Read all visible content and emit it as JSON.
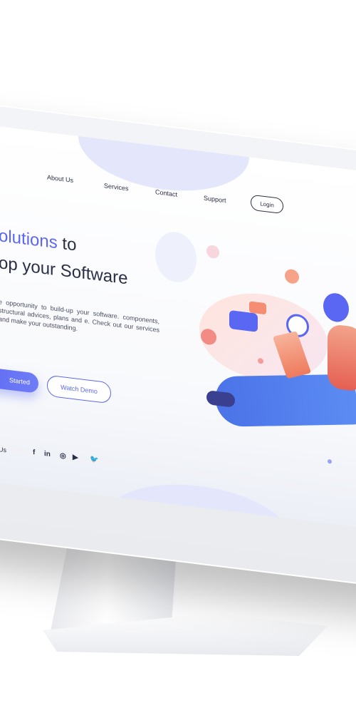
{
  "nav": {
    "about": "About Us",
    "services": "Services",
    "contact": "Contact",
    "support": "Support",
    "login": "Login"
  },
  "hero": {
    "line1_accent": "olutions",
    "line1_rest": " to",
    "line2": "op your Software",
    "description": "e opportunity to build-up your software. components, structural advices, plans and e. Check out our services and make your outstanding.",
    "get_started": "Started",
    "watch_demo": "Watch Demo"
  },
  "social": {
    "label": "ow Us",
    "facebook": "f",
    "linkedin": "in",
    "instagram": "◎",
    "youtube": "▶",
    "twitter": "🐦"
  },
  "colors": {
    "accent": "#5a67f2",
    "text": "#2a2f45",
    "orange": "#f48d72"
  }
}
